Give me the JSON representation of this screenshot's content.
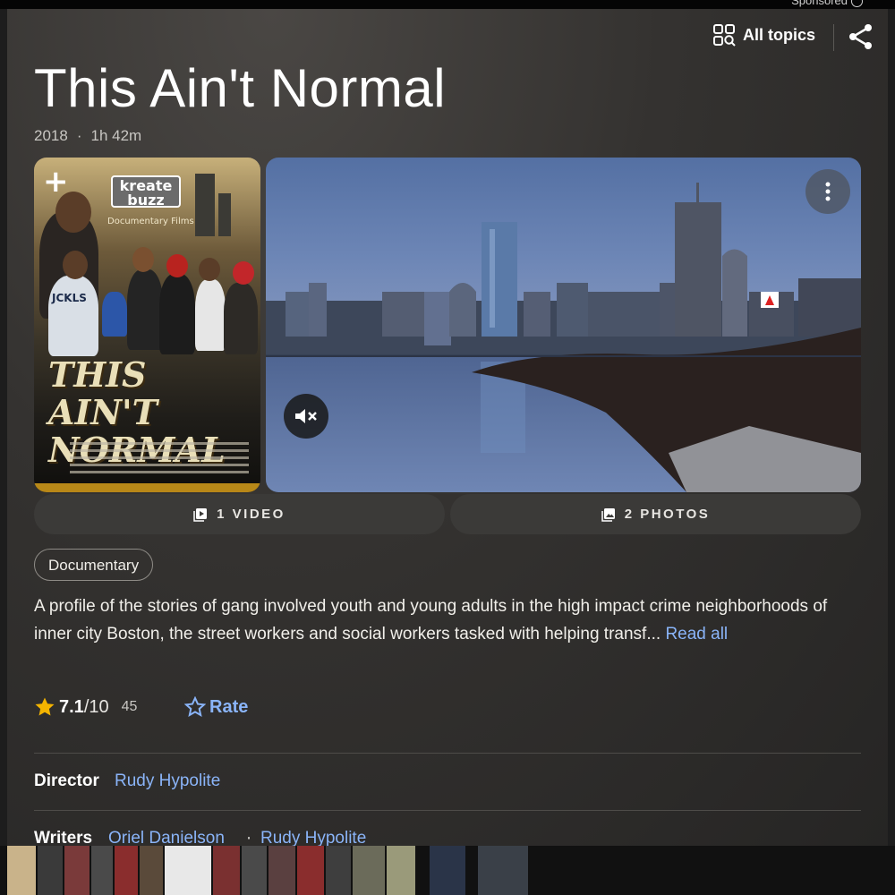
{
  "status_bar": {
    "sponsored_label": "Sponsored"
  },
  "header": {
    "all_topics_label": "All topics",
    "title": "This Ain't Normal",
    "year": "2018",
    "duration": "1h 42m"
  },
  "poster": {
    "brand_line1": "kreate",
    "brand_line2": "buzz",
    "brand_sub": "Documentary Films",
    "shirt_text": "JCKLS",
    "poster_title": "THIS AIN'T NORMAL"
  },
  "media": {
    "video_label": "1 VIDEO",
    "photos_label": "2 PHOTOS"
  },
  "genre_chip": "Documentary",
  "description": {
    "text": "A profile of the stories of gang involved youth and young adults in the high impact crime neighborhoods of inner city Boston, the street workers and social workers tasked with helping transf...",
    "read_all": "Read all"
  },
  "rating": {
    "score": "7.1",
    "out_of": "/10",
    "count": "45",
    "rate_label": "Rate"
  },
  "credits": {
    "director_label": "Director",
    "director": "Rudy Hypolite",
    "writers_label": "Writers",
    "writers": [
      "Oriel Danielson",
      "Rudy Hypolite"
    ],
    "separator": "·"
  },
  "colors": {
    "accent_link": "#8ab4f8",
    "star": "#f4b400",
    "panel_bg": "#343230"
  },
  "icons": [
    "topics-grid-icon",
    "share-icon",
    "plus-icon",
    "more-vert-icon",
    "volume-off-icon",
    "video-library-icon",
    "photo-library-icon",
    "star-icon",
    "star-outline-icon"
  ]
}
